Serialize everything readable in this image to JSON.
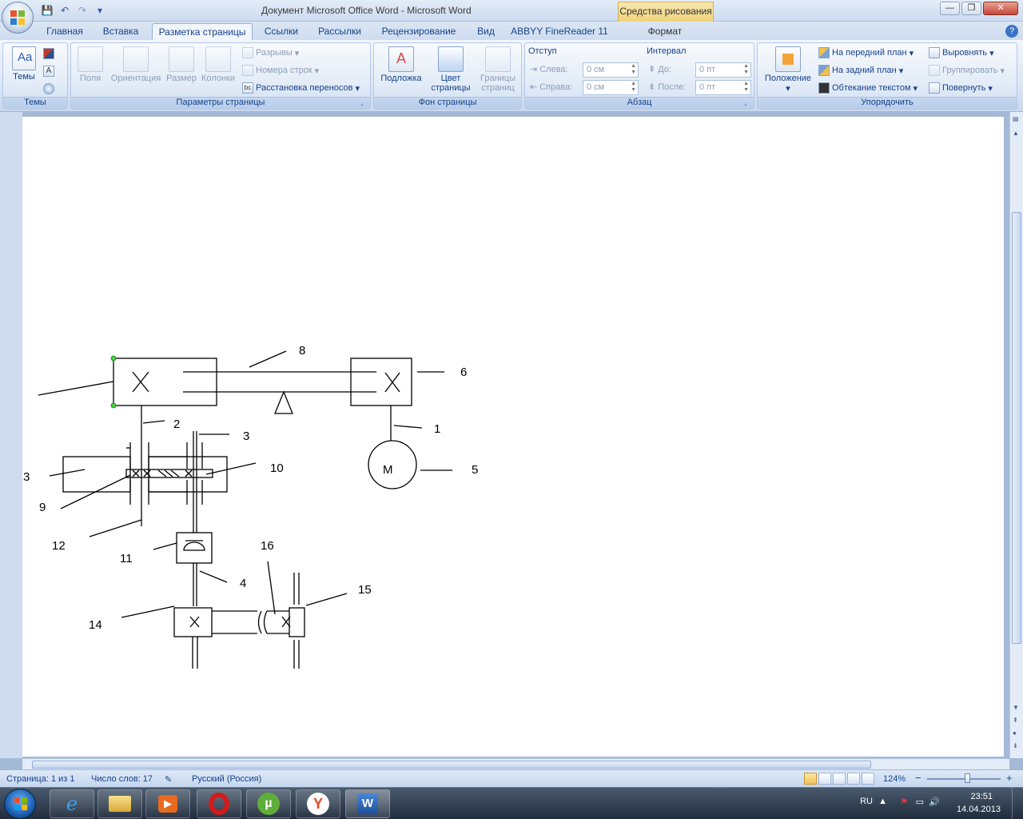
{
  "window": {
    "title": "Документ Microsoft Office Word - Microsoft Word",
    "context_tab_header": "Средства рисования",
    "controls": {
      "minimize": "—",
      "maximize": "❐",
      "close": "✕"
    }
  },
  "quick_access": {
    "save": "💾",
    "undo": "↶",
    "redo": "↷",
    "customize": "▾"
  },
  "tabs": [
    {
      "label": "Главная"
    },
    {
      "label": "Вставка"
    },
    {
      "label": "Разметка страницы"
    },
    {
      "label": "Ссылки"
    },
    {
      "label": "Рассылки"
    },
    {
      "label": "Рецензирование"
    },
    {
      "label": "Вид"
    },
    {
      "label": "ABBYY FineReader 11"
    },
    {
      "label": "Формат"
    }
  ],
  "ribbon": {
    "themes": {
      "group_label": "Темы",
      "themes_button": "Темы"
    },
    "page_setup": {
      "group_label": "Параметры страницы",
      "margins": "Поля",
      "orientation": "Ориентация",
      "size": "Размер",
      "columns": "Колонки",
      "breaks": "Разрывы",
      "line_numbers": "Номера строк",
      "hyphenation": "Расстановка переносов"
    },
    "page_background": {
      "group_label": "Фон страницы",
      "watermark": "Подложка",
      "page_color_line1": "Цвет",
      "page_color_line2": "страницы",
      "page_borders_line1": "Границы",
      "page_borders_line2": "страниц"
    },
    "paragraph": {
      "group_label": "Абзац",
      "indent_header": "Отступ",
      "spacing_header": "Интервал",
      "indent_left_label": "Слева:",
      "indent_left_value": "0 см",
      "indent_right_label": "Справа:",
      "indent_right_value": "0 см",
      "spacing_before_label": "До:",
      "spacing_before_value": "0 пт",
      "spacing_after_label": "После:",
      "spacing_after_value": "0 пт"
    },
    "arrange": {
      "group_label": "Упорядочить",
      "position": "Положение",
      "bring_front": "На передний план",
      "send_back": "На задний план",
      "text_wrap": "Обтекание текстом",
      "align": "Выровнять",
      "group": "Группировать",
      "rotate": "Повернуть"
    }
  },
  "diagram": {
    "labels": [
      "8",
      "6",
      "2",
      "1",
      "3",
      "3",
      "10",
      "5",
      "9",
      "12",
      "11",
      "16",
      "4",
      "15",
      "14"
    ],
    "motor_symbol": "M"
  },
  "statusbar": {
    "page": "Страница: 1 из 1",
    "words": "Число слов: 17",
    "language": "Русский (Россия)",
    "zoom": "124%",
    "zoom_minus": "−",
    "zoom_plus": "+"
  },
  "taskbar": {
    "language": "RU",
    "time": "23:51",
    "date": "14.04.2013"
  }
}
